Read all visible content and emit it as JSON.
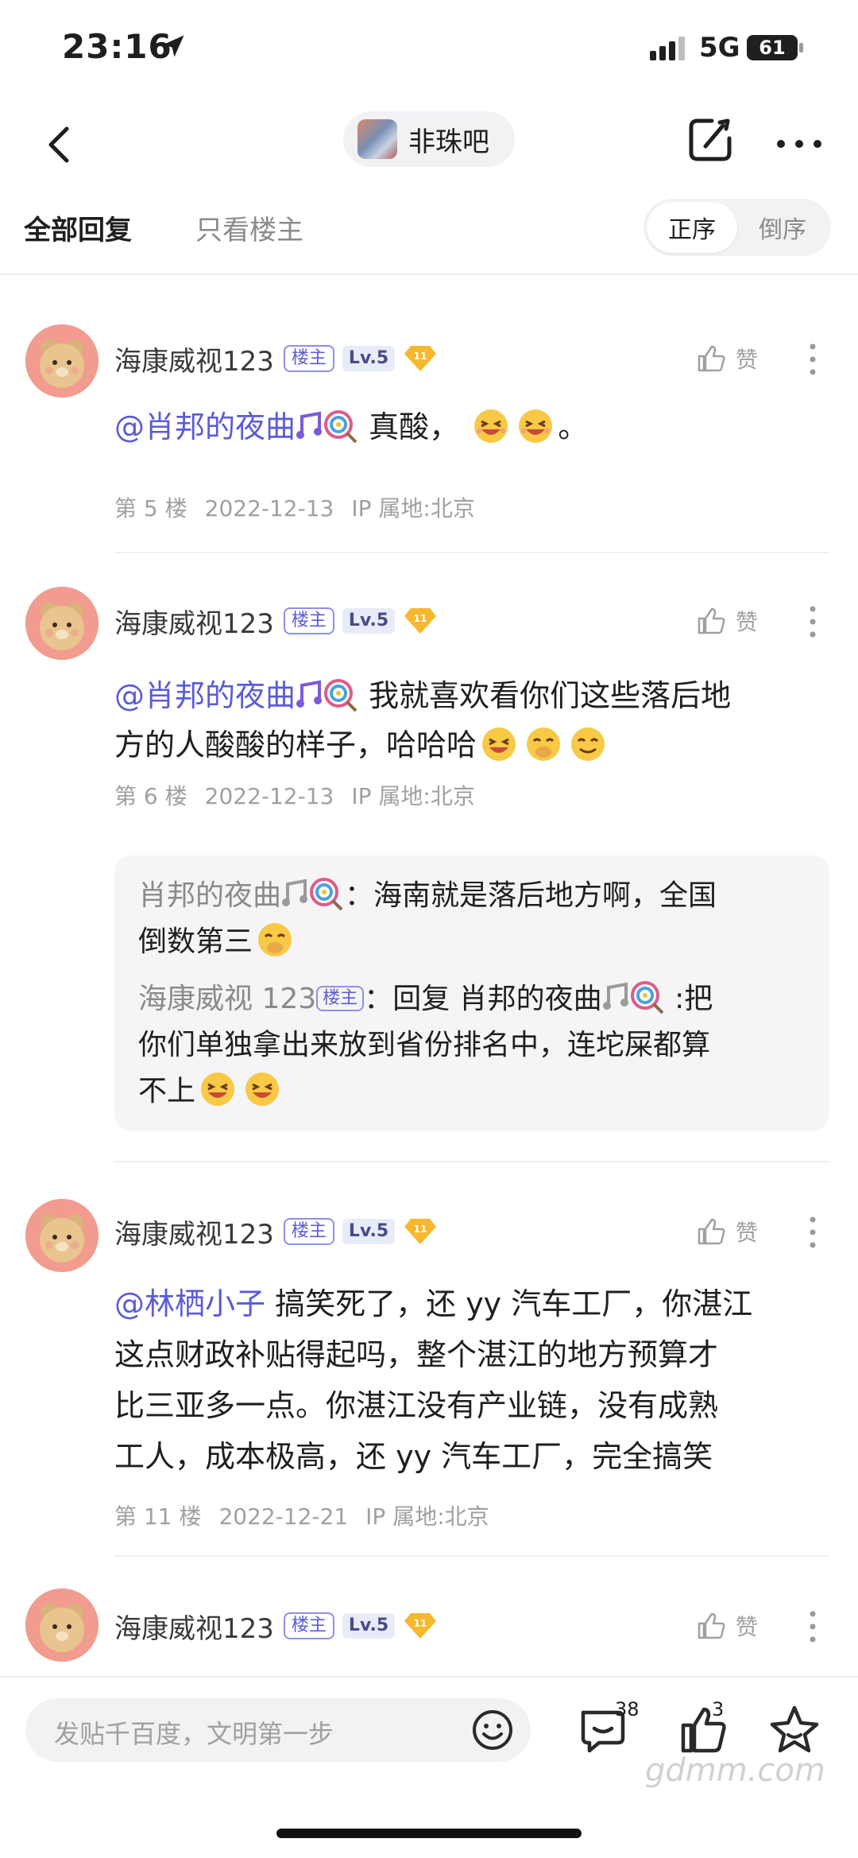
{
  "status_bar": {
    "time": "23:16",
    "network": "5G",
    "battery": "61"
  },
  "nav": {
    "forum_name": "非珠吧"
  },
  "tabs": {
    "all": "全部回复",
    "owner_only": "只看楼主"
  },
  "sort": {
    "asc": "正序",
    "desc": "倒序"
  },
  "common": {
    "username": "海康威视123",
    "owner_badge": "楼主",
    "level": "Lv.5",
    "gem_level": "11",
    "like": "赞"
  },
  "posts": [
    {
      "mention": "@肖邦的夜曲",
      "text": "真酸，",
      "tail": "。",
      "floor": "第 5 楼",
      "date": "2022-12-13",
      "ip": "IP 属地:北京"
    },
    {
      "mention": "@肖邦的夜曲",
      "text_line1": "我就喜欢看你们这些落后地",
      "text_line2": "方的人酸酸的样子，哈哈哈",
      "floor": "第 6 楼",
      "date": "2022-12-13",
      "ip": "IP 属地:北京",
      "replies": [
        {
          "name": "肖邦的夜曲",
          "text_line1": "：海南就是落后地方啊，全国",
          "text_line2": "倒数第三"
        },
        {
          "name": "海康威视 123",
          "badge": "楼主",
          "reply_prefix": "：回复 肖邦的夜曲",
          "text_line1": ":把",
          "text_line2": "你们单独拿出来放到省份排名中，连坨屎都算",
          "text_line3": "不上"
        }
      ]
    },
    {
      "mention": "@林栖小子",
      "text_line1": "搞笑死了，还 yy 汽车工厂，你湛江",
      "text_line2": "这点财政补贴得起吗，整个湛江的地方预算才",
      "text_line3": "比三亚多一点。你湛江没有产业链，没有成熟",
      "text_line4": "工人，成本极高，还 yy 汽车工厂，完全搞笑",
      "floor": "第 11 楼",
      "date": "2022-12-21",
      "ip": "IP 属地:北京"
    }
  ],
  "bottom": {
    "placeholder": "发贴千百度，文明第一步",
    "comment_count": "38",
    "like_count": "3"
  },
  "watermark": "gdmm.com",
  "colors": {
    "accent": "#5b5bd6",
    "gray_text": "#a0a0a0",
    "gem": "#f5b82e"
  }
}
